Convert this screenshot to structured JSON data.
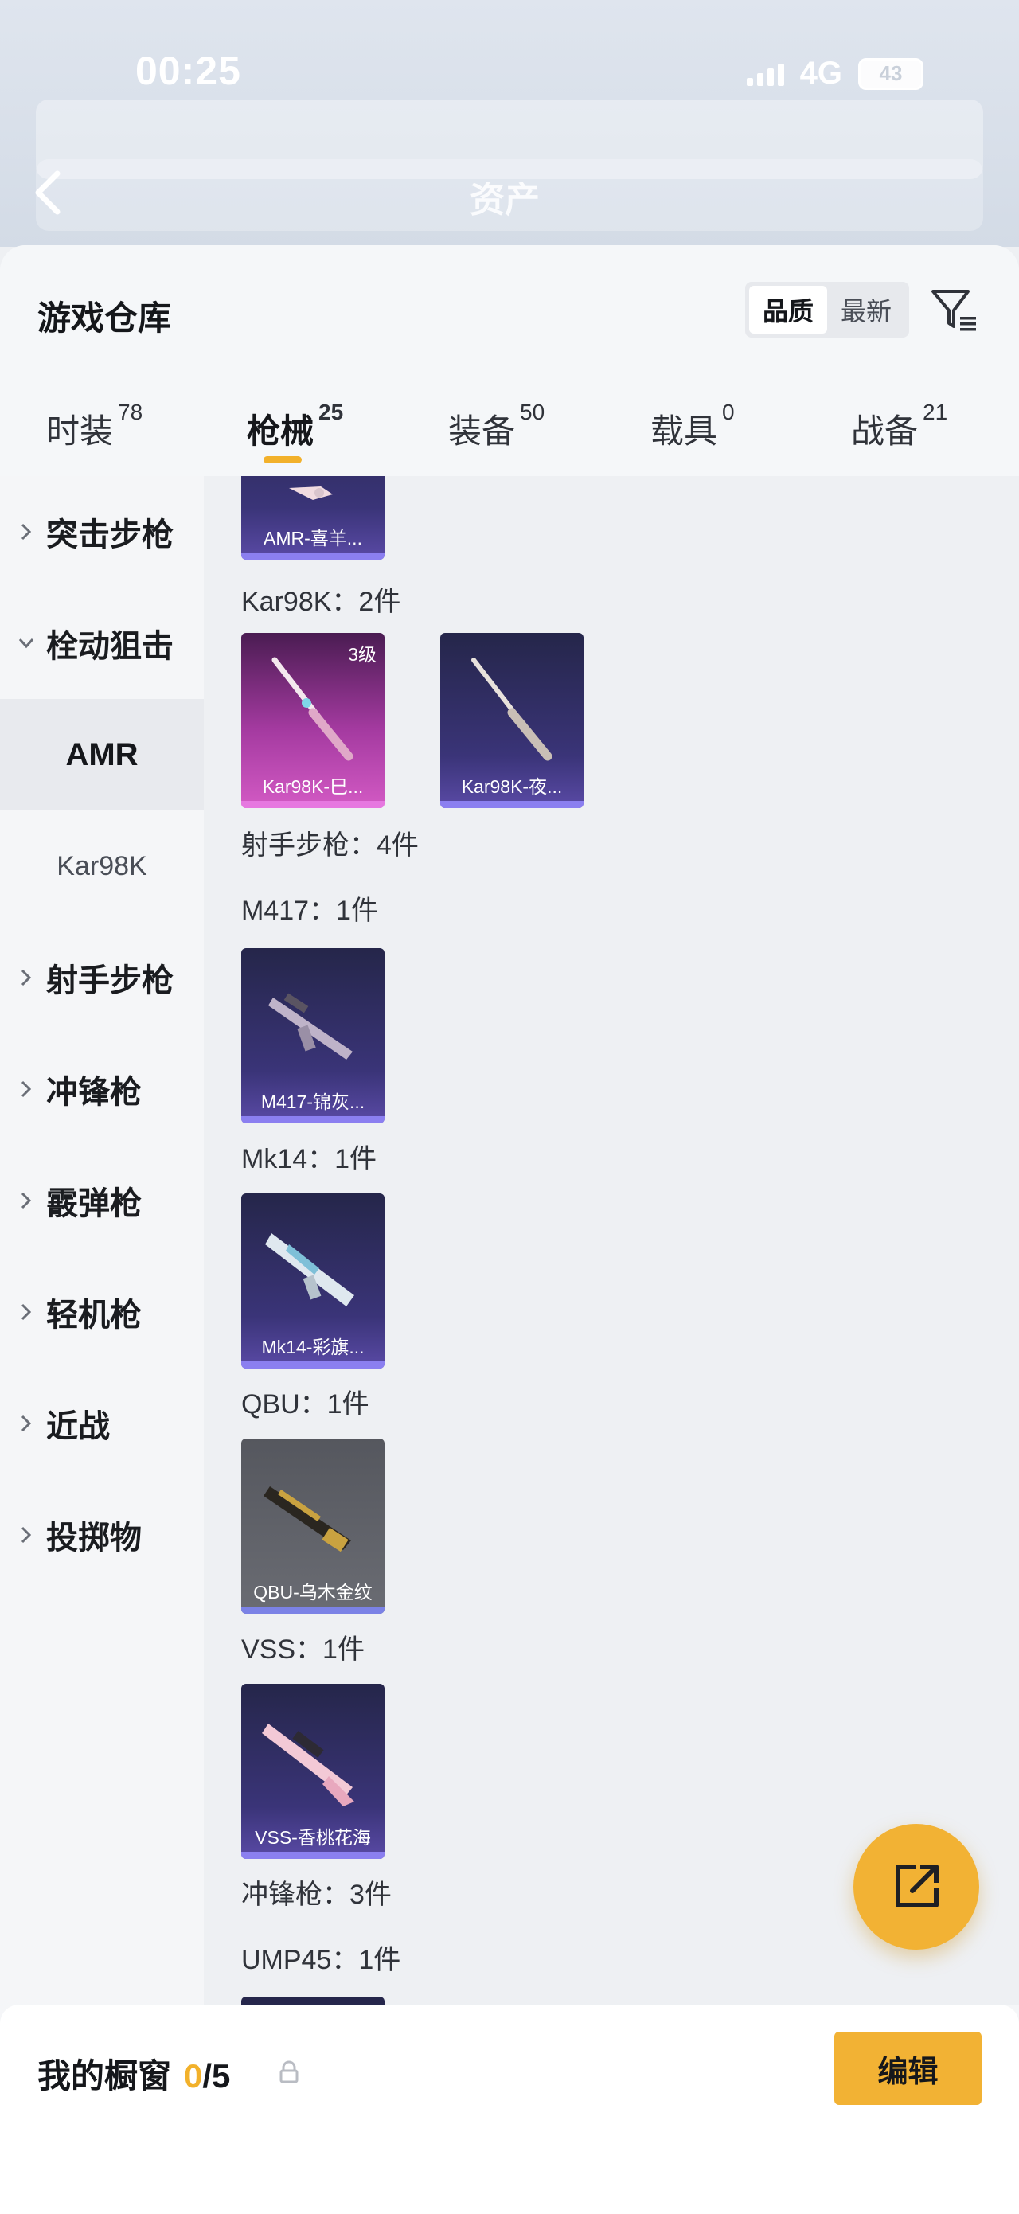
{
  "status_bar": {
    "time": "00:25",
    "network": "4G",
    "battery": "43"
  },
  "backdrop": {
    "title": "资产"
  },
  "warehouse": {
    "title": "游戏仓库",
    "sort_options": [
      "品质",
      "最新"
    ],
    "active_sort": "品质"
  },
  "tabs": [
    {
      "label": "时装",
      "count": "78"
    },
    {
      "label": "枪械",
      "count": "25"
    },
    {
      "label": "装备",
      "count": "50"
    },
    {
      "label": "载具",
      "count": "0"
    },
    {
      "label": "战备",
      "count": "21"
    }
  ],
  "categories": [
    {
      "label": "突击步枪"
    },
    {
      "label": "栓动狙击"
    },
    {
      "label": "AMR"
    },
    {
      "label": "Kar98K"
    },
    {
      "label": "射手步枪"
    },
    {
      "label": "冲锋枪"
    },
    {
      "label": "霰弹枪"
    },
    {
      "label": "轻机枪"
    },
    {
      "label": "近战"
    },
    {
      "label": "投掷物"
    }
  ],
  "content": {
    "amr_card": "AMR-喜羊...",
    "kar98k_label": "Kar98K：2件",
    "kar98k_cards": [
      {
        "caption": "Kar98K-巳...",
        "level": "3级"
      },
      {
        "caption": "Kar98K-夜..."
      }
    ],
    "dmr_label": "射手步枪：4件",
    "m417_label": "M417：1件",
    "m417_card": "M417-锦灰...",
    "mk14_label": "Mk14：1件",
    "mk14_card": "Mk14-彩旗...",
    "qbu_label": "QBU：1件",
    "qbu_card": "QBU-乌木金纹",
    "vss_label": "VSS：1件",
    "vss_card": "VSS-香桃花海",
    "smg_label": "冲锋枪：3件",
    "ump_label": "UMP45：1件"
  },
  "showcase": {
    "title": "我的橱窗",
    "count": "0",
    "total": "/5",
    "edit_label": "编辑"
  },
  "colors": {
    "accent": "#f2b234",
    "purple_card": "#3a3478",
    "pink_card": "#a43aa0"
  }
}
